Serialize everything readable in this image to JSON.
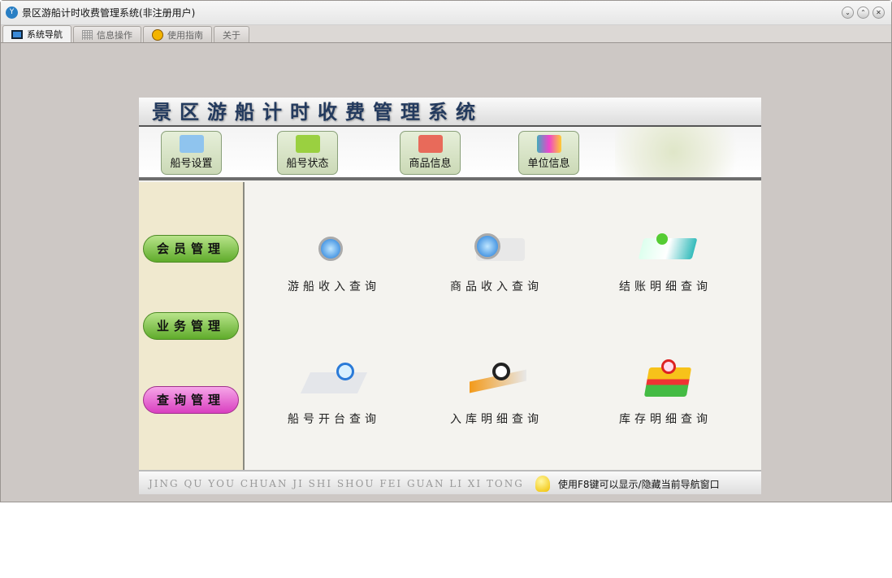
{
  "window": {
    "title": "景区游船计时收费管理系统(非注册用户)",
    "minimize": "⌄",
    "maximize": "⌃",
    "close": "✕"
  },
  "tabs": [
    {
      "label": "系统导航"
    },
    {
      "label": "信息操作"
    },
    {
      "label": "使用指南"
    },
    {
      "label": "关于"
    }
  ],
  "panel": {
    "title": "景区游船计时收费管理系统",
    "toolbar": [
      {
        "label": "船号设置"
      },
      {
        "label": "船号状态"
      },
      {
        "label": "商品信息"
      },
      {
        "label": "单位信息"
      }
    ],
    "side": [
      {
        "label": "会员管理"
      },
      {
        "label": "业务管理"
      },
      {
        "label": "查询管理"
      }
    ],
    "items": [
      {
        "label": "游船收入查询"
      },
      {
        "label": "商品收入查询"
      },
      {
        "label": "结账明细查询"
      },
      {
        "label": "船号开台查询"
      },
      {
        "label": "入库明细查询"
      },
      {
        "label": "库存明细查询"
      }
    ],
    "pinyin": "JING QU YOU CHUAN JI SHI SHOU FEI GUAN LI XI TONG",
    "tip": "使用F8键可以显示/隐藏当前导航窗口"
  }
}
